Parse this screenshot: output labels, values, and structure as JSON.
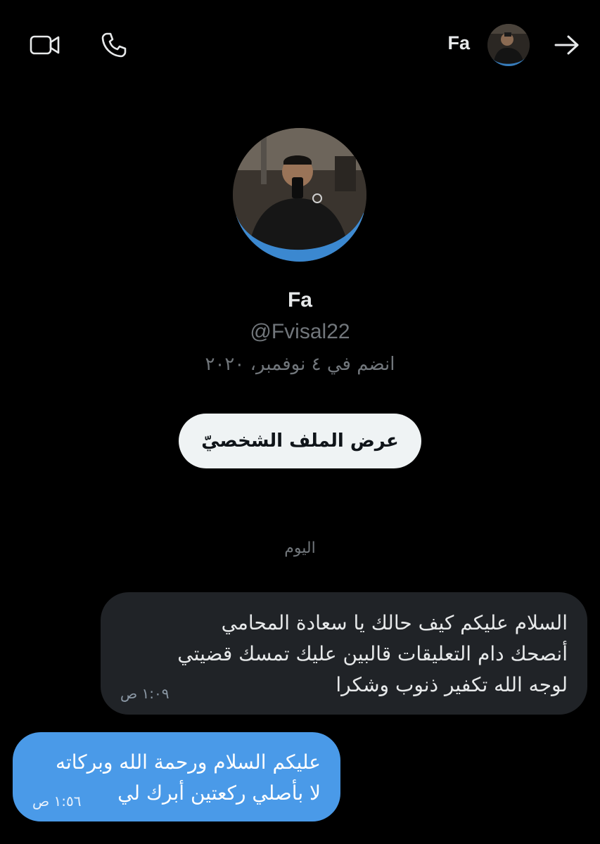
{
  "header": {
    "name": "Fa",
    "icons": [
      "video-icon",
      "phone-icon",
      "back-arrow-icon"
    ]
  },
  "profile": {
    "name": "Fa",
    "handle": "@Fvisal22",
    "joined": "انضم في ٤ نوفمبر، ٢٠٢٠",
    "view_profile_label": "عرض الملف الشخصيّ"
  },
  "conversation": {
    "day_separator": "اليوم",
    "messages": [
      {
        "direction": "incoming",
        "text": "السلام عليكم كيف حالك يا سعادة المحامي\nأنصحك دام التعليقات قالبين عليك تمسك قضيتي\nلوجه الله تكفير ذنوب وشكرا",
        "time": "١:٠٩ ص"
      },
      {
        "direction": "outgoing",
        "text": "عليكم السلام ورحمة الله وبركاته\nلا بأصلي ركعتين أبرك لي",
        "time": "١:٥٦ ص"
      }
    ]
  },
  "colors": {
    "background": "#000000",
    "incoming_bubble": "#202327",
    "outgoing_bubble": "#4a9ae8",
    "button_bg": "#eff3f4",
    "muted_text": "#71767b"
  }
}
